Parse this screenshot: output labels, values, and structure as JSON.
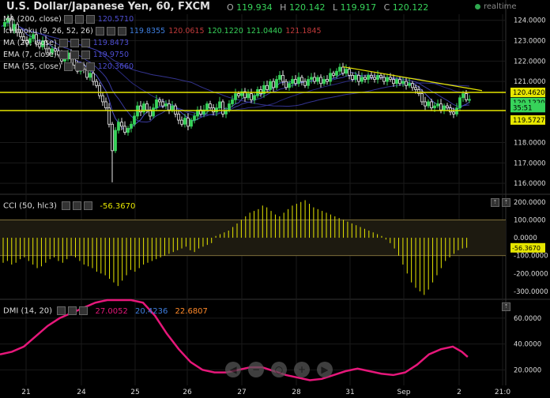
{
  "header": {
    "title": "U.S. Dollar/Japanese Yen, 60, FXCM",
    "ohlc": [
      {
        "k": "O",
        "v": "119.934"
      },
      {
        "k": "H",
        "v": "120.142"
      },
      {
        "k": "L",
        "v": "119.917"
      },
      {
        "k": "C",
        "v": "120.122"
      }
    ],
    "realtime": "realtime"
  },
  "indicators": [
    {
      "label": "MA (200, close)",
      "values": [
        "120.5710"
      ],
      "colors": [
        "#4d4dd0"
      ]
    },
    {
      "label": "Ichimoku (9, 26, 52, 26)",
      "values": [
        "119.8355",
        "120.0615",
        "120.1220",
        "121.0440",
        "121.1845"
      ],
      "colors": [
        "#3f7fe0",
        "#c03a3a",
        "#37d35a",
        "#37d35a",
        "#c03a3a"
      ]
    },
    {
      "label": "MA (20, close)",
      "values": [
        "119.8473"
      ],
      "colors": [
        "#4d4dd0"
      ]
    },
    {
      "label": "EMA (7, close)",
      "values": [
        "119.9750"
      ],
      "colors": [
        "#4d4dd0"
      ]
    },
    {
      "label": "EMA (55, close)",
      "values": [
        "120.3660"
      ],
      "colors": [
        "#4d4dd0"
      ]
    }
  ],
  "colors": {
    "bull": "#37d35a",
    "bear": "#e8e8e8",
    "hline": "#e6e600",
    "ma": "#4848c8",
    "dmi": "#e6177a",
    "cci": "#e6e600",
    "zone": "#1d1a10"
  },
  "chart_data": [
    {
      "type": "candlestick",
      "title": "U.S. Dollar/Japanese Yen, 60, FXCM",
      "x_ticks": [
        "21",
        "24",
        "25",
        "26",
        "27",
        "28",
        "31",
        "Sep",
        "2",
        "21:0"
      ],
      "y_ticks": [
        "124.0000",
        "123.0000",
        "122.0000",
        "121.0000",
        "118.0000",
        "117.0000",
        "116.0000"
      ],
      "ylim": [
        115.5,
        124.3
      ],
      "horizontal_levels": [
        120.462,
        119.5727
      ],
      "price_labels": [
        "120.4620",
        "120.1220",
        "35:51",
        "119.5727"
      ],
      "close_path": [
        [
          0,
          123.7
        ],
        [
          4,
          123.9
        ],
        [
          8,
          124.1
        ],
        [
          12,
          123.5
        ],
        [
          16,
          123.8
        ],
        [
          20,
          123.4
        ],
        [
          24,
          123.2
        ],
        [
          28,
          123.0
        ],
        [
          32,
          122.9
        ],
        [
          36,
          123.1
        ],
        [
          40,
          123.3
        ],
        [
          44,
          122.9
        ],
        [
          48,
          122.7
        ],
        [
          52,
          123.0
        ],
        [
          56,
          122.6
        ],
        [
          60,
          122.4
        ],
        [
          64,
          122.6
        ],
        [
          68,
          122.5
        ],
        [
          72,
          122.3
        ],
        [
          76,
          122.0
        ],
        [
          80,
          122.1
        ],
        [
          84,
          122.4
        ],
        [
          88,
          122.1
        ],
        [
          92,
          121.8
        ],
        [
          96,
          121.5
        ],
        [
          100,
          121.8
        ],
        [
          104,
          121.6
        ],
        [
          108,
          121.2
        ],
        [
          112,
          121.4
        ],
        [
          116,
          121.0
        ],
        [
          120,
          120.8
        ],
        [
          124,
          120.3
        ],
        [
          128,
          120.0
        ],
        [
          132,
          119.7
        ],
        [
          136,
          118.9
        ],
        [
          140,
          117.6
        ],
        [
          144,
          118.6
        ],
        [
          148,
          119.0
        ],
        [
          152,
          118.8
        ],
        [
          156,
          118.5
        ],
        [
          160,
          118.7
        ],
        [
          164,
          118.9
        ],
        [
          168,
          119.3
        ],
        [
          172,
          119.8
        ],
        [
          176,
          119.5
        ],
        [
          180,
          119.9
        ],
        [
          184,
          119.6
        ],
        [
          188,
          119.3
        ],
        [
          192,
          119.7
        ],
        [
          196,
          120.1
        ],
        [
          200,
          120.0
        ],
        [
          204,
          119.8
        ],
        [
          208,
          119.9
        ],
        [
          212,
          119.6
        ],
        [
          216,
          119.8
        ],
        [
          220,
          119.4
        ],
        [
          224,
          119.1
        ],
        [
          228,
          118.9
        ],
        [
          232,
          119.2
        ],
        [
          236,
          118.8
        ],
        [
          240,
          119.1
        ],
        [
          244,
          119.3
        ],
        [
          248,
          119.6
        ],
        [
          252,
          119.4
        ],
        [
          256,
          119.6
        ],
        [
          260,
          119.9
        ],
        [
          264,
          119.7
        ],
        [
          268,
          119.5
        ],
        [
          272,
          119.7
        ],
        [
          276,
          120.0
        ],
        [
          280,
          119.4
        ],
        [
          284,
          119.6
        ],
        [
          288,
          119.9
        ],
        [
          292,
          120.1
        ],
        [
          296,
          120.4
        ],
        [
          300,
          120.3
        ],
        [
          304,
          120.5
        ],
        [
          308,
          120.2
        ],
        [
          312,
          120.4
        ],
        [
          316,
          120.1
        ],
        [
          320,
          120.3
        ],
        [
          324,
          120.6
        ],
        [
          328,
          120.4
        ],
        [
          332,
          120.8
        ],
        [
          336,
          120.6
        ],
        [
          340,
          121.0
        ],
        [
          344,
          120.7
        ],
        [
          348,
          121.1
        ],
        [
          352,
          121.3
        ],
        [
          356,
          121.0
        ],
        [
          360,
          120.7
        ],
        [
          364,
          120.9
        ],
        [
          368,
          121.1
        ],
        [
          372,
          120.9
        ],
        [
          376,
          121.2
        ],
        [
          380,
          121.0
        ],
        [
          384,
          120.8
        ],
        [
          388,
          121.1
        ],
        [
          392,
          121.2
        ],
        [
          396,
          121.0
        ],
        [
          400,
          121.2
        ],
        [
          404,
          120.9
        ],
        [
          408,
          121.1
        ],
        [
          412,
          121.0
        ],
        [
          416,
          121.4
        ],
        [
          420,
          121.3
        ],
        [
          424,
          121.5
        ],
        [
          428,
          121.7
        ],
        [
          432,
          121.4
        ],
        [
          436,
          121.6
        ],
        [
          440,
          121.3
        ],
        [
          444,
          121.1
        ],
        [
          448,
          121.3
        ],
        [
          452,
          121.0
        ],
        [
          456,
          121.2
        ],
        [
          460,
          121.1
        ],
        [
          464,
          121.3
        ],
        [
          468,
          121.2
        ],
        [
          472,
          121.1
        ],
        [
          476,
          121.3
        ],
        [
          480,
          121.2
        ],
        [
          484,
          121.0
        ],
        [
          488,
          121.2
        ],
        [
          492,
          121.1
        ],
        [
          496,
          120.9
        ],
        [
          500,
          121.1
        ],
        [
          504,
          120.9
        ],
        [
          508,
          121.0
        ],
        [
          512,
          120.8
        ],
        [
          516,
          120.9
        ],
        [
          520,
          120.7
        ],
        [
          524,
          120.6
        ],
        [
          528,
          120.4
        ],
        [
          532,
          120.0
        ],
        [
          536,
          119.8
        ],
        [
          540,
          120.0
        ],
        [
          544,
          119.7
        ],
        [
          548,
          119.8
        ],
        [
          552,
          119.9
        ],
        [
          556,
          119.6
        ],
        [
          560,
          119.8
        ],
        [
          564,
          119.7
        ],
        [
          568,
          119.5
        ],
        [
          572,
          119.4
        ],
        [
          576,
          119.7
        ],
        [
          580,
          120.2
        ],
        [
          584,
          120.4
        ],
        [
          588,
          120.1
        ],
        [
          592,
          120.12
        ]
      ]
    },
    {
      "type": "bar",
      "title": "CCI (50, hlc3)",
      "value_label": "-56.3670",
      "y_ticks": [
        "200.0000",
        "100.0000",
        "0.0000",
        "-100.0000",
        "-200.0000",
        "-300.0000"
      ],
      "ylim": [
        -340,
        230
      ],
      "bands": [
        100,
        -100
      ],
      "values": [
        -140,
        -130,
        -150,
        -140,
        -120,
        -110,
        -130,
        -150,
        -170,
        -160,
        -140,
        -120,
        -110,
        -130,
        -140,
        -120,
        -100,
        -110,
        -130,
        -150,
        -160,
        -170,
        -190,
        -200,
        -210,
        -230,
        -250,
        -270,
        -240,
        -210,
        -180,
        -190,
        -170,
        -150,
        -140,
        -130,
        -120,
        -110,
        -100,
        -90,
        -80,
        -70,
        -60,
        -50,
        -70,
        -80,
        -60,
        -50,
        -40,
        -30,
        10,
        20,
        30,
        40,
        60,
        80,
        100,
        120,
        140,
        150,
        160,
        180,
        170,
        150,
        130,
        120,
        140,
        160,
        180,
        190,
        200,
        210,
        190,
        170,
        160,
        150,
        140,
        130,
        120,
        110,
        100,
        90,
        80,
        70,
        60,
        50,
        40,
        30,
        20,
        10,
        -10,
        -30,
        -60,
        -100,
        -150,
        -200,
        -250,
        -280,
        -300,
        -320,
        -290,
        -250,
        -210,
        -170,
        -130,
        -110,
        -90,
        -70,
        -60,
        -56
      ]
    },
    {
      "type": "line",
      "title": "DMI (14, 20)",
      "values": [
        "27.0052",
        "20.4236",
        "22.6807"
      ],
      "value_colors": [
        "#e6177a",
        "#3f7fe0",
        "#ff8a2a"
      ],
      "y_ticks": [
        "60.0000",
        "40.0000",
        "20.0000"
      ],
      "ylim": [
        8,
        74
      ],
      "adx": [
        [
          0,
          32
        ],
        [
          20,
          34
        ],
        [
          40,
          38
        ],
        [
          60,
          46
        ],
        [
          80,
          54
        ],
        [
          100,
          60
        ],
        [
          120,
          64
        ],
        [
          140,
          68
        ],
        [
          160,
          72
        ],
        [
          180,
          74
        ],
        [
          200,
          74
        ],
        [
          220,
          74
        ],
        [
          240,
          72
        ],
        [
          260,
          62
        ],
        [
          280,
          48
        ],
        [
          300,
          36
        ],
        [
          320,
          26
        ],
        [
          340,
          20
        ],
        [
          360,
          18
        ],
        [
          380,
          18
        ],
        [
          400,
          20
        ],
        [
          420,
          22
        ],
        [
          440,
          22
        ],
        [
          460,
          19
        ],
        [
          480,
          16
        ],
        [
          500,
          14
        ],
        [
          520,
          12
        ],
        [
          540,
          13
        ],
        [
          560,
          16
        ],
        [
          580,
          19
        ],
        [
          600,
          21
        ],
        [
          620,
          19
        ],
        [
          640,
          17
        ],
        [
          660,
          16
        ],
        [
          680,
          18
        ],
        [
          700,
          24
        ],
        [
          720,
          32
        ],
        [
          740,
          36
        ],
        [
          760,
          38
        ],
        [
          775,
          34
        ],
        [
          785,
          30
        ]
      ]
    }
  ],
  "nav_buttons": [
    "◀",
    "−",
    "○",
    "+",
    "▶"
  ]
}
